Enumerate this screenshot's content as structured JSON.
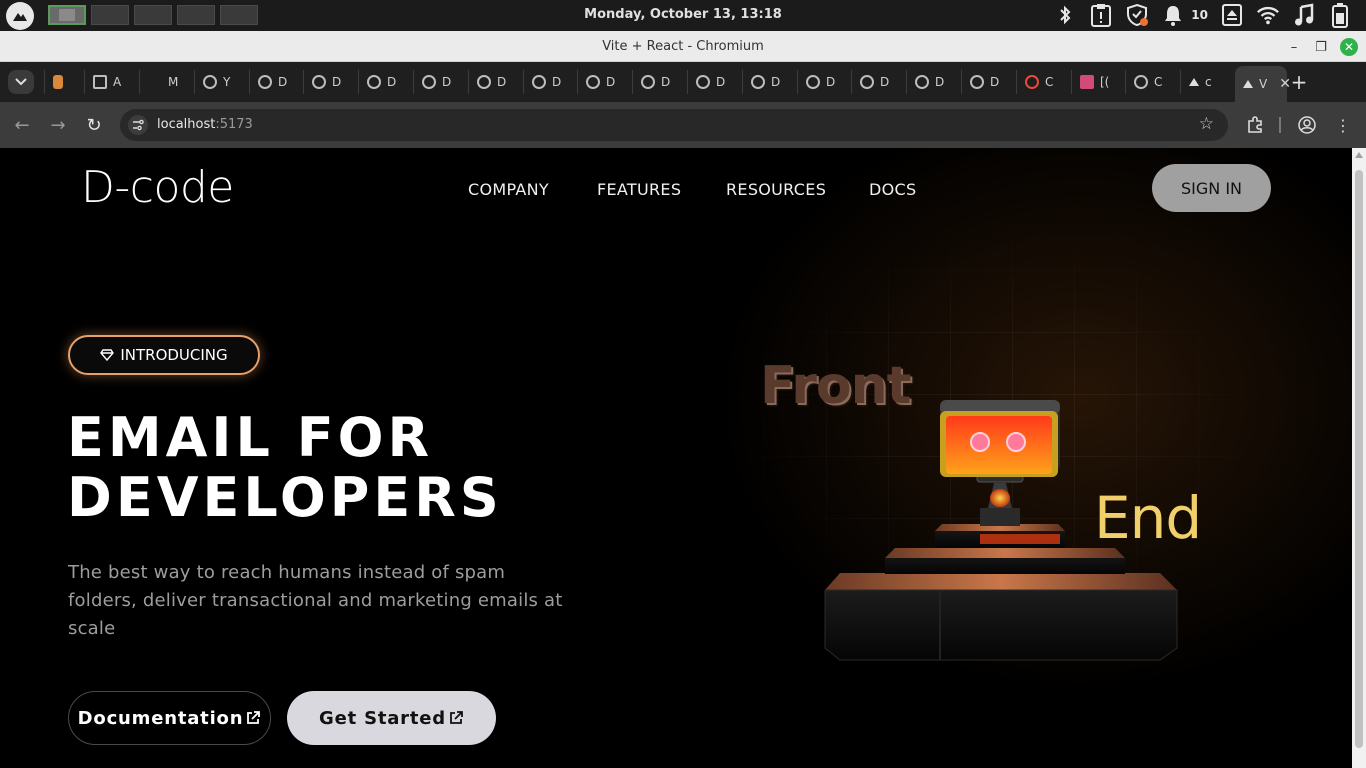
{
  "os": {
    "datetime": "Monday, October 13, 13:18",
    "notification_count": "10",
    "workspace_count": 5
  },
  "browser": {
    "window_title": "Vite + React - Chromium",
    "tabs": [
      {
        "label": "",
        "icon": "app-icon"
      },
      {
        "label": "A",
        "icon": "folder-icon"
      },
      {
        "label": "M",
        "icon": "blank-icon"
      },
      {
        "label": "Y",
        "icon": "github-icon"
      },
      {
        "label": "D",
        "icon": "github-icon"
      },
      {
        "label": "D",
        "icon": "github-icon"
      },
      {
        "label": "D",
        "icon": "github-icon"
      },
      {
        "label": "D",
        "icon": "github-icon"
      },
      {
        "label": "D",
        "icon": "github-icon"
      },
      {
        "label": "D",
        "icon": "github-icon"
      },
      {
        "label": "D",
        "icon": "github-icon"
      },
      {
        "label": "D",
        "icon": "github-icon"
      },
      {
        "label": "D",
        "icon": "github-icon"
      },
      {
        "label": "D",
        "icon": "github-icon"
      },
      {
        "label": "D",
        "icon": "github-icon"
      },
      {
        "label": "D",
        "icon": "github-icon"
      },
      {
        "label": "D",
        "icon": "github-icon"
      },
      {
        "label": "D",
        "icon": "github-icon"
      },
      {
        "label": "C",
        "icon": "chrome-icon"
      },
      {
        "label": "[(",
        "icon": "gmail-icon"
      },
      {
        "label": "C",
        "icon": "globe-icon"
      },
      {
        "label": "c",
        "icon": "drive-icon"
      },
      {
        "label": "V",
        "icon": "vite-icon",
        "active": true
      }
    ],
    "url_host": "localhost",
    "url_port": ":5173"
  },
  "site": {
    "logo": "D-code",
    "nav": [
      "COMPANY",
      "FEATURES",
      "RESOURCES",
      "DOCS"
    ],
    "signin_label": "SIGN IN",
    "badge_label": "INTRODUCING",
    "headline_line1": "EMAIL FOR",
    "headline_line2": "DEVELOPERS",
    "subtext": "The best way to reach humans instead of spam folders, deliver transactional and marketing emails at scale",
    "btn_docs": "Documentation",
    "btn_start": "Get Started",
    "art_front": "Front",
    "art_end": "End"
  },
  "colors": {
    "accent_orange": "#e8a06a",
    "end_text": "#f1cf6a",
    "signin_bg": "#a0a0a0",
    "cta_bg": "#d8d8de"
  }
}
